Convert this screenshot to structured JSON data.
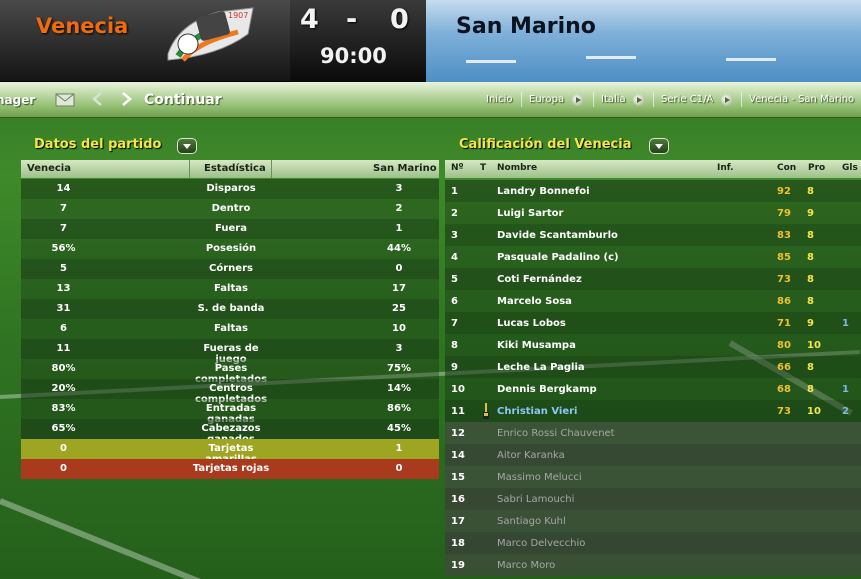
{
  "match": {
    "home_team": "Venecia",
    "away_team": "San Marino",
    "home_score": "4",
    "separator": "-",
    "away_score": "0",
    "clock": "90:00",
    "crest_year": "1907"
  },
  "toolbar": {
    "manager_label": "nager",
    "continue_label": "Continuar",
    "breadcrumbs": [
      "Inicio",
      "Europa",
      "Italia",
      "Serie C1/A",
      "Venecia - San Marino"
    ]
  },
  "stats": {
    "title": "Datos del partido",
    "columns": {
      "home": "Venecia",
      "stat": "Estadística",
      "away": "San Marino"
    },
    "rows": [
      {
        "home": "14",
        "name": "Disparos",
        "away": "3"
      },
      {
        "home": "7",
        "name": "Dentro",
        "away": "2"
      },
      {
        "home": "7",
        "name": "Fuera",
        "away": "1"
      },
      {
        "home": "56%",
        "name": "Posesión",
        "away": "44%"
      },
      {
        "home": "5",
        "name": "Córners",
        "away": "0"
      },
      {
        "home": "13",
        "name": "Faltas",
        "away": "17"
      },
      {
        "home": "31",
        "name": "S. de banda",
        "away": "25"
      },
      {
        "home": "6",
        "name": "Faltas",
        "away": "10"
      },
      {
        "home": "11",
        "name": "Fueras de juego",
        "away": "3"
      },
      {
        "home": "80%",
        "name": "Pases completados",
        "away": "75%"
      },
      {
        "home": "20%",
        "name": "Centros completados",
        "away": "14%"
      },
      {
        "home": "83%",
        "name": "Entradas ganadas",
        "away": "86%"
      },
      {
        "home": "65%",
        "name": "Cabezazos ganados",
        "away": "45%"
      },
      {
        "home": "0",
        "name": "Tarjetas amarillas",
        "away": "1"
      },
      {
        "home": "0",
        "name": "Tarjetas rojas",
        "away": "0"
      }
    ]
  },
  "ratings": {
    "title": "Calificación del Venecia",
    "columns": {
      "num": "Nº",
      "t": "T",
      "name": "Nombre",
      "inf": "Inf.",
      "con": "Con",
      "pro": "Pro",
      "gls": "Gls"
    },
    "players": [
      {
        "num": "1",
        "name": "Landry Bonnefoi",
        "con": "92",
        "pro": "8",
        "gls": ""
      },
      {
        "num": "2",
        "name": "Luigi Sartor",
        "con": "79",
        "pro": "9",
        "gls": ""
      },
      {
        "num": "3",
        "name": "Davide Scantamburlo",
        "con": "83",
        "pro": "8",
        "gls": ""
      },
      {
        "num": "4",
        "name": "Pasquale Padalino (c)",
        "con": "85",
        "pro": "8",
        "gls": ""
      },
      {
        "num": "5",
        "name": "Coti Fernández",
        "con": "73",
        "pro": "8",
        "gls": ""
      },
      {
        "num": "6",
        "name": "Marcelo Sosa",
        "con": "86",
        "pro": "8",
        "gls": ""
      },
      {
        "num": "7",
        "name": "Lucas Lobos",
        "con": "71",
        "pro": "9",
        "gls": "1"
      },
      {
        "num": "8",
        "name": "Kiki Musampa",
        "con": "80",
        "pro": "10",
        "gls": ""
      },
      {
        "num": "9",
        "name": "Leche La Paglia",
        "con": "66",
        "pro": "8",
        "gls": ""
      },
      {
        "num": "10",
        "name": "Dennis Bergkamp",
        "con": "68",
        "pro": "8",
        "gls": "1"
      },
      {
        "num": "11",
        "name": "Christian Vieri",
        "con": "73",
        "pro": "10",
        "gls": "2"
      }
    ],
    "substitutes": [
      {
        "num": "12",
        "name": "Enrico Rossi Chauvenet"
      },
      {
        "num": "14",
        "name": "Aitor Karanka"
      },
      {
        "num": "15",
        "name": "Massimo Melucci"
      },
      {
        "num": "16",
        "name": "Sabri Lamouchi"
      },
      {
        "num": "17",
        "name": "Santiago Kuhl"
      },
      {
        "num": "18",
        "name": "Marco Delvecchio"
      },
      {
        "num": "19",
        "name": "Marco Moro"
      }
    ]
  },
  "icons": {
    "mail": "envelope-icon",
    "back": "back-arrow-icon",
    "forward": "forward-arrow-icon",
    "boot": "boot-icon"
  },
  "colors": {
    "home": "#f06a10",
    "title": "#f2e64a",
    "yellow_row": "#9ea521",
    "red_row": "#aa3a1e"
  }
}
